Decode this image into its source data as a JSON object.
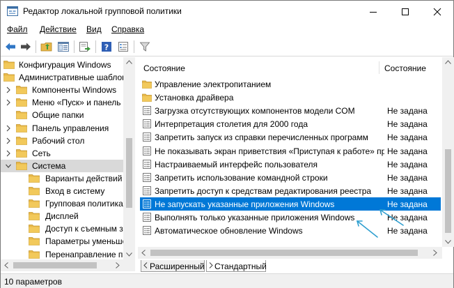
{
  "window": {
    "title": "Редактор локальной групповой политики"
  },
  "menu": [
    {
      "label": "Файл"
    },
    {
      "label": "Действие"
    },
    {
      "label": "Вид"
    },
    {
      "label": "Справка"
    }
  ],
  "toolbar": {
    "icons": [
      "back-arrow-icon",
      "forward-arrow-icon",
      "up-folder-icon",
      "show-hide-tree-icon",
      "export-list-icon",
      "help-icon",
      "properties-icon",
      "filter-icon"
    ]
  },
  "tree": [
    {
      "label": "Конфигурация Windows",
      "level": 0,
      "expander": "none"
    },
    {
      "label": "Административные шаблоны",
      "level": 0,
      "expander": "none"
    },
    {
      "label": "Компоненты Windows",
      "level": 1,
      "expander": "collapsed"
    },
    {
      "label": "Меню «Пуск» и панель задач",
      "level": 1,
      "expander": "collapsed"
    },
    {
      "label": "Общие папки",
      "level": 1,
      "expander": "none"
    },
    {
      "label": "Панель управления",
      "level": 1,
      "expander": "collapsed"
    },
    {
      "label": "Рабочий стол",
      "level": 1,
      "expander": "collapsed"
    },
    {
      "label": "Сеть",
      "level": 1,
      "expander": "collapsed"
    },
    {
      "label": "Система",
      "level": 1,
      "expander": "expanded",
      "selected": true
    },
    {
      "label": "Варианты действий",
      "level": 2,
      "expander": "none"
    },
    {
      "label": "Вход в систему",
      "level": 2,
      "expander": "none"
    },
    {
      "label": "Групповая политика",
      "level": 2,
      "expander": "none"
    },
    {
      "label": "Дисплей",
      "level": 2,
      "expander": "none"
    },
    {
      "label": "Доступ к съемным запоминающим",
      "level": 2,
      "expander": "none"
    },
    {
      "label": "Параметры уменьшения",
      "level": 2,
      "expander": "none"
    },
    {
      "label": "Перенаправление папок",
      "level": 2,
      "expander": "none"
    }
  ],
  "list": {
    "header_name": "Состояние",
    "header_state": "Состояние",
    "rows": [
      {
        "name": "Управление электропитанием",
        "state": "",
        "kind": "folder"
      },
      {
        "name": "Установка драйвера",
        "state": "",
        "kind": "folder"
      },
      {
        "name": "Загрузка отсутствующих компонентов модели COM",
        "state": "Не задана",
        "kind": "setting"
      },
      {
        "name": "Интерпретация столетия для 2000 года",
        "state": "Не задана",
        "kind": "setting"
      },
      {
        "name": "Запретить запуск из справки перечисленных программ",
        "state": "Не задана",
        "kind": "setting"
      },
      {
        "name": "Не показывать экран приветствия «Приступая к работе» при входе",
        "state": "Не задана",
        "kind": "setting"
      },
      {
        "name": "Настраиваемый интерфейс пользователя",
        "state": "Не задана",
        "kind": "setting"
      },
      {
        "name": "Запретить использование командной строки",
        "state": "Не задана",
        "kind": "setting"
      },
      {
        "name": "Запретить доступ к средствам редактирования реестра",
        "state": "Не задана",
        "kind": "setting"
      },
      {
        "name": "Не запускать указанные приложения Windows",
        "state": "Не задана",
        "kind": "setting",
        "selected": true
      },
      {
        "name": "Выполнять только указанные приложения Windows",
        "state": "Не задана",
        "kind": "setting"
      },
      {
        "name": "Автоматическое обновление Windows",
        "state": "Не задана",
        "kind": "setting"
      }
    ]
  },
  "tabs": [
    {
      "label": "Расширенный"
    },
    {
      "label": "Стандартный"
    }
  ],
  "status": {
    "text": "10 параметров"
  },
  "colors": {
    "selection": "#0078d7",
    "folder": "#e8b84a",
    "annotation_arrow": "#2f9fd0"
  }
}
